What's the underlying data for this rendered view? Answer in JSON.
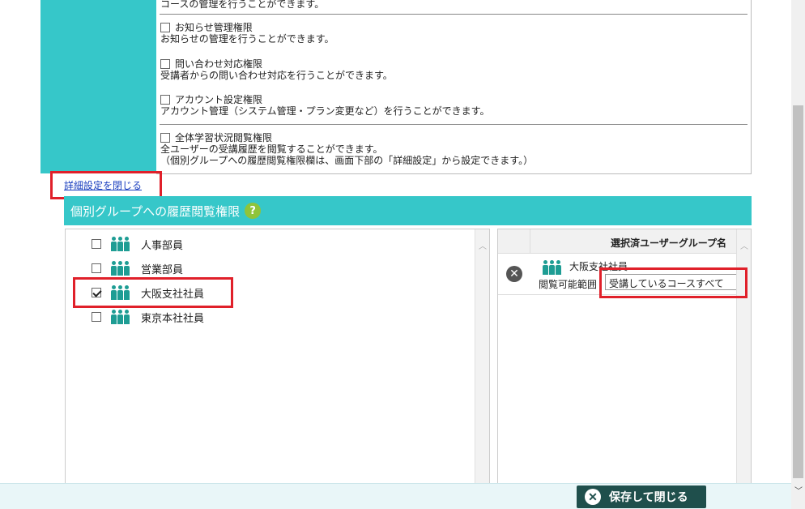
{
  "permissions": {
    "truncated_top": "コースの管理を行うことができます。",
    "items": [
      {
        "title": "お知らせ管理権限",
        "desc": "お知らせの管理を行うことができます。",
        "desc2": ""
      },
      {
        "title": "問い合わせ対応権限",
        "desc": "受講者からの問い合わせ対応を行うことができます。",
        "desc2": ""
      },
      {
        "title": "アカウント設定権限",
        "desc": "アカウント管理（システム管理・プラン変更など）を行うことができます。",
        "desc2": ""
      },
      {
        "title": "全体学習状況閲覧権限",
        "desc": "全ユーザーの受講履歴を閲覧することができます。",
        "desc2": "（個別グループへの履歴閲覧権限欄は、画面下部の「詳細設定」から設定できます。）"
      }
    ]
  },
  "close_details_link": "詳細設定を閉じる",
  "section": {
    "title": "個別グループへの履歴閲覧権限",
    "help": "?"
  },
  "groups": [
    {
      "name": "人事部員",
      "checked": false
    },
    {
      "name": "営業部員",
      "checked": false
    },
    {
      "name": "大阪支社社員",
      "checked": true
    },
    {
      "name": "東京本社社員",
      "checked": false
    }
  ],
  "selected_panel": {
    "header": "選択済ユーザーグループ名",
    "rows": [
      {
        "group": "大阪支社社員",
        "range_label": "閲覧可能範囲",
        "range_value": "受講しているコースすべて"
      }
    ]
  },
  "footer": {
    "save_label": "保存して閉じる"
  },
  "colors": {
    "teal": "#36c7c9",
    "highlight": "#e0202a",
    "save_button": "#1f4f4c"
  }
}
